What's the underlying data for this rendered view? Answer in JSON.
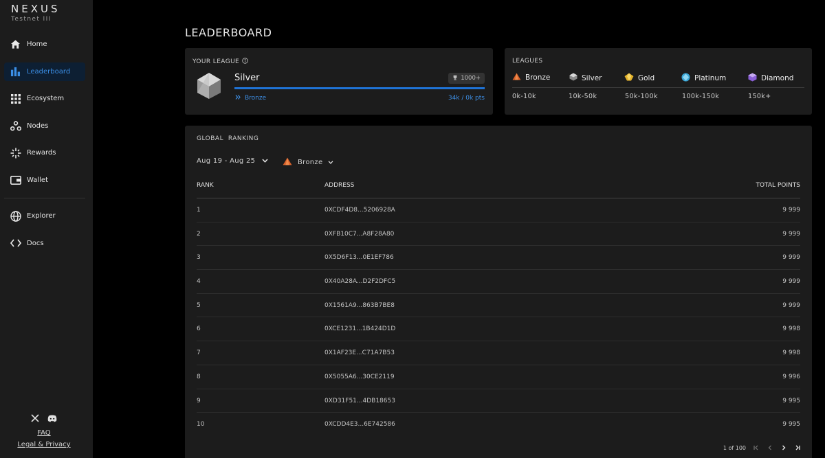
{
  "brand": {
    "name": "NEXUS",
    "subtitle": "Testnet III"
  },
  "sidebar": {
    "items": [
      {
        "label": "Home",
        "icon": "home-icon"
      },
      {
        "label": "Leaderboard",
        "icon": "bar-chart-icon",
        "active": true
      },
      {
        "label": "Ecosystem",
        "icon": "grid-icon"
      },
      {
        "label": "Nodes",
        "icon": "nodes-icon"
      },
      {
        "label": "Rewards",
        "icon": "sparkle-icon"
      },
      {
        "label": "Wallet",
        "icon": "wallet-icon"
      }
    ],
    "secondary": [
      {
        "label": "Explorer",
        "icon": "globe-icon"
      },
      {
        "label": "Docs",
        "icon": "code-icon"
      }
    ],
    "footer": {
      "faq": "FAQ",
      "legal": "Legal & Privacy",
      "socials": [
        "x-icon",
        "discord-icon"
      ]
    }
  },
  "page": {
    "title": "LEADERBOARD"
  },
  "your_league": {
    "header": "YOUR LEAGUE",
    "name": "Silver",
    "badge": "1000+",
    "next_league": "Bronze",
    "points": "34k / 0k pts",
    "progress": 1.0,
    "accent": "#1f73d6"
  },
  "leagues": {
    "header": "LEAGUES",
    "items": [
      {
        "name": "Bronze",
        "range": "0k-10k",
        "color": "#d9622b"
      },
      {
        "name": "Silver",
        "range": "10k-50k",
        "color": "#a8a8a8"
      },
      {
        "name": "Gold",
        "range": "50k-100k",
        "color": "#e3b22a"
      },
      {
        "name": "Platinum",
        "range": "100k-150k",
        "color": "#3aa6d6"
      },
      {
        "name": "Diamond",
        "range": "150k+",
        "color": "#8a5fd6"
      }
    ]
  },
  "ranking": {
    "header": "GLOBAL  RANKING",
    "date_filter": "Aug 19 - Aug 25",
    "league_filter": "Bronze",
    "columns": {
      "rank": "RANK",
      "address": "ADDRESS",
      "points": "TOTAL POINTS"
    },
    "rows": [
      {
        "rank": "1",
        "address": "0XCDF4D8...5206928A",
        "points": "9 999"
      },
      {
        "rank": "2",
        "address": "0XFB10C7...A8F28A80",
        "points": "9 999"
      },
      {
        "rank": "3",
        "address": "0X5D6F13...0E1EF786",
        "points": "9 999"
      },
      {
        "rank": "4",
        "address": "0X40A28A...D2F2DFC5",
        "points": "9 999"
      },
      {
        "rank": "5",
        "address": "0X1561A9...863B7BE8",
        "points": "9 999"
      },
      {
        "rank": "6",
        "address": "0XCE1231...1B424D1D",
        "points": "9 998"
      },
      {
        "rank": "7",
        "address": "0X1AF23E...C71A7B53",
        "points": "9 998"
      },
      {
        "rank": "8",
        "address": "0X5055A6...30CE2119",
        "points": "9 996"
      },
      {
        "rank": "9",
        "address": "0XD31F51...4DB18653",
        "points": "9 995"
      },
      {
        "rank": "10",
        "address": "0XCDD4E3...6E742586",
        "points": "9 995"
      }
    ],
    "pagination": "1 of 100"
  }
}
